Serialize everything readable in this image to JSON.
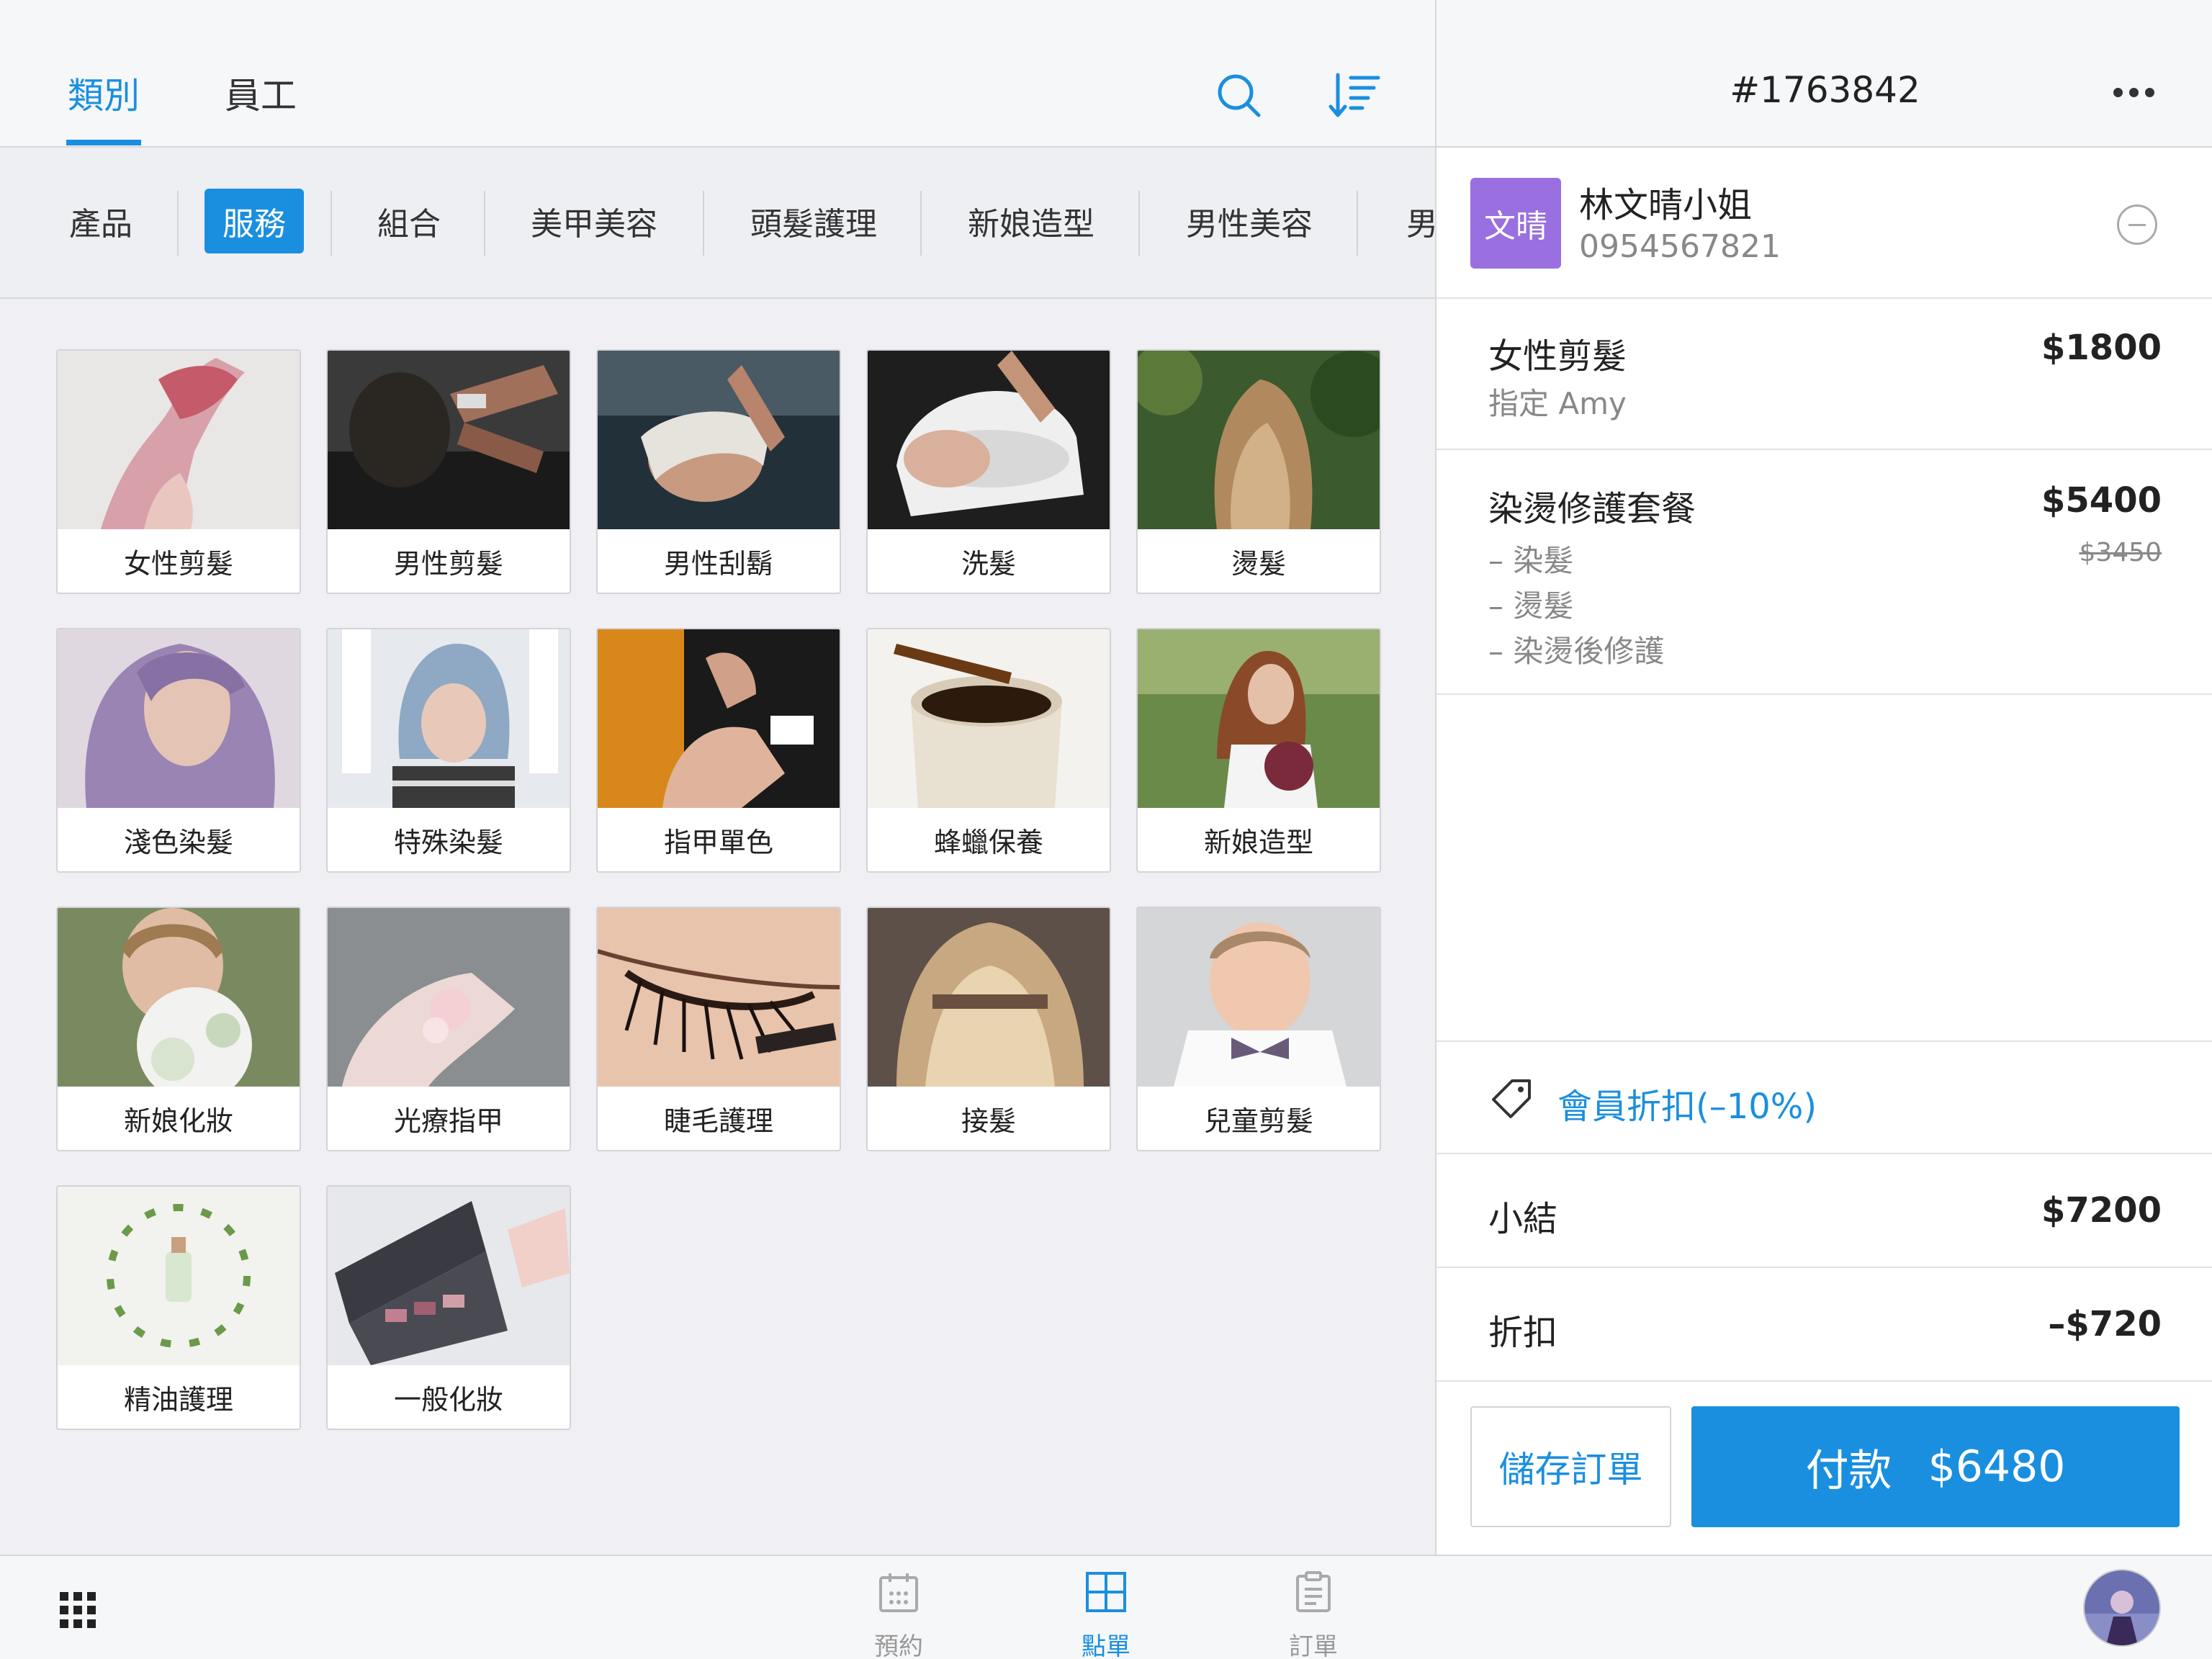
{
  "header": {
    "tabs": [
      {
        "label": "類別",
        "active": true
      },
      {
        "label": "員工",
        "active": false
      }
    ],
    "icons": [
      "search-icon",
      "sort-icon"
    ]
  },
  "categories": [
    {
      "label": "產品",
      "active": false
    },
    {
      "label": "服務",
      "active": true
    },
    {
      "label": "組合",
      "active": false
    },
    {
      "label": "美甲美容",
      "active": false
    },
    {
      "label": "頭髮護理",
      "active": false
    },
    {
      "label": "新娘造型",
      "active": false
    },
    {
      "label": "男性美容",
      "active": false
    },
    {
      "label": "男",
      "active": false
    }
  ],
  "services": [
    {
      "label": "女性剪髮"
    },
    {
      "label": "男性剪髮"
    },
    {
      "label": "男性刮鬍"
    },
    {
      "label": "洗髮"
    },
    {
      "label": "燙髮"
    },
    {
      "label": "淺色染髮"
    },
    {
      "label": "特殊染髮"
    },
    {
      "label": "指甲單色"
    },
    {
      "label": "蜂蠟保養"
    },
    {
      "label": "新娘造型"
    },
    {
      "label": "新娘化妝"
    },
    {
      "label": "光療指甲"
    },
    {
      "label": "睫毛護理"
    },
    {
      "label": "接髮"
    },
    {
      "label": "兒童剪髮"
    },
    {
      "label": "精油護理"
    },
    {
      "label": "一般化妝"
    }
  ],
  "order": {
    "number": "#1763842",
    "customer": {
      "initials": "文晴",
      "name": "林文晴小姐",
      "phone": "0954567821",
      "avatar_color": "#9a6fe0"
    },
    "items": [
      {
        "name": "女性剪髮",
        "sub": "指定 Amy",
        "price": "$1800"
      },
      {
        "name": "染燙修護套餐",
        "price": "$5400",
        "old_price": "$3450",
        "parts": [
          "– 染髮",
          "– 燙髮",
          "– 染燙後修護"
        ]
      }
    ],
    "promo": "會員折扣(–10%)",
    "subtotal_label": "小結",
    "subtotal": "$7200",
    "discount_label": "折扣",
    "discount": "–$720",
    "save_label": "儲存訂單",
    "pay_label": "付款",
    "pay_amount": "$6480"
  },
  "bottom_nav": [
    {
      "label": "預約",
      "icon": "calendar-icon",
      "active": false
    },
    {
      "label": "點單",
      "icon": "grid-order-icon",
      "active": true
    },
    {
      "label": "訂單",
      "icon": "clipboard-icon",
      "active": false
    }
  ],
  "colors": {
    "accent": "#1a8fdf",
    "avatar": "#9a6fe0"
  }
}
